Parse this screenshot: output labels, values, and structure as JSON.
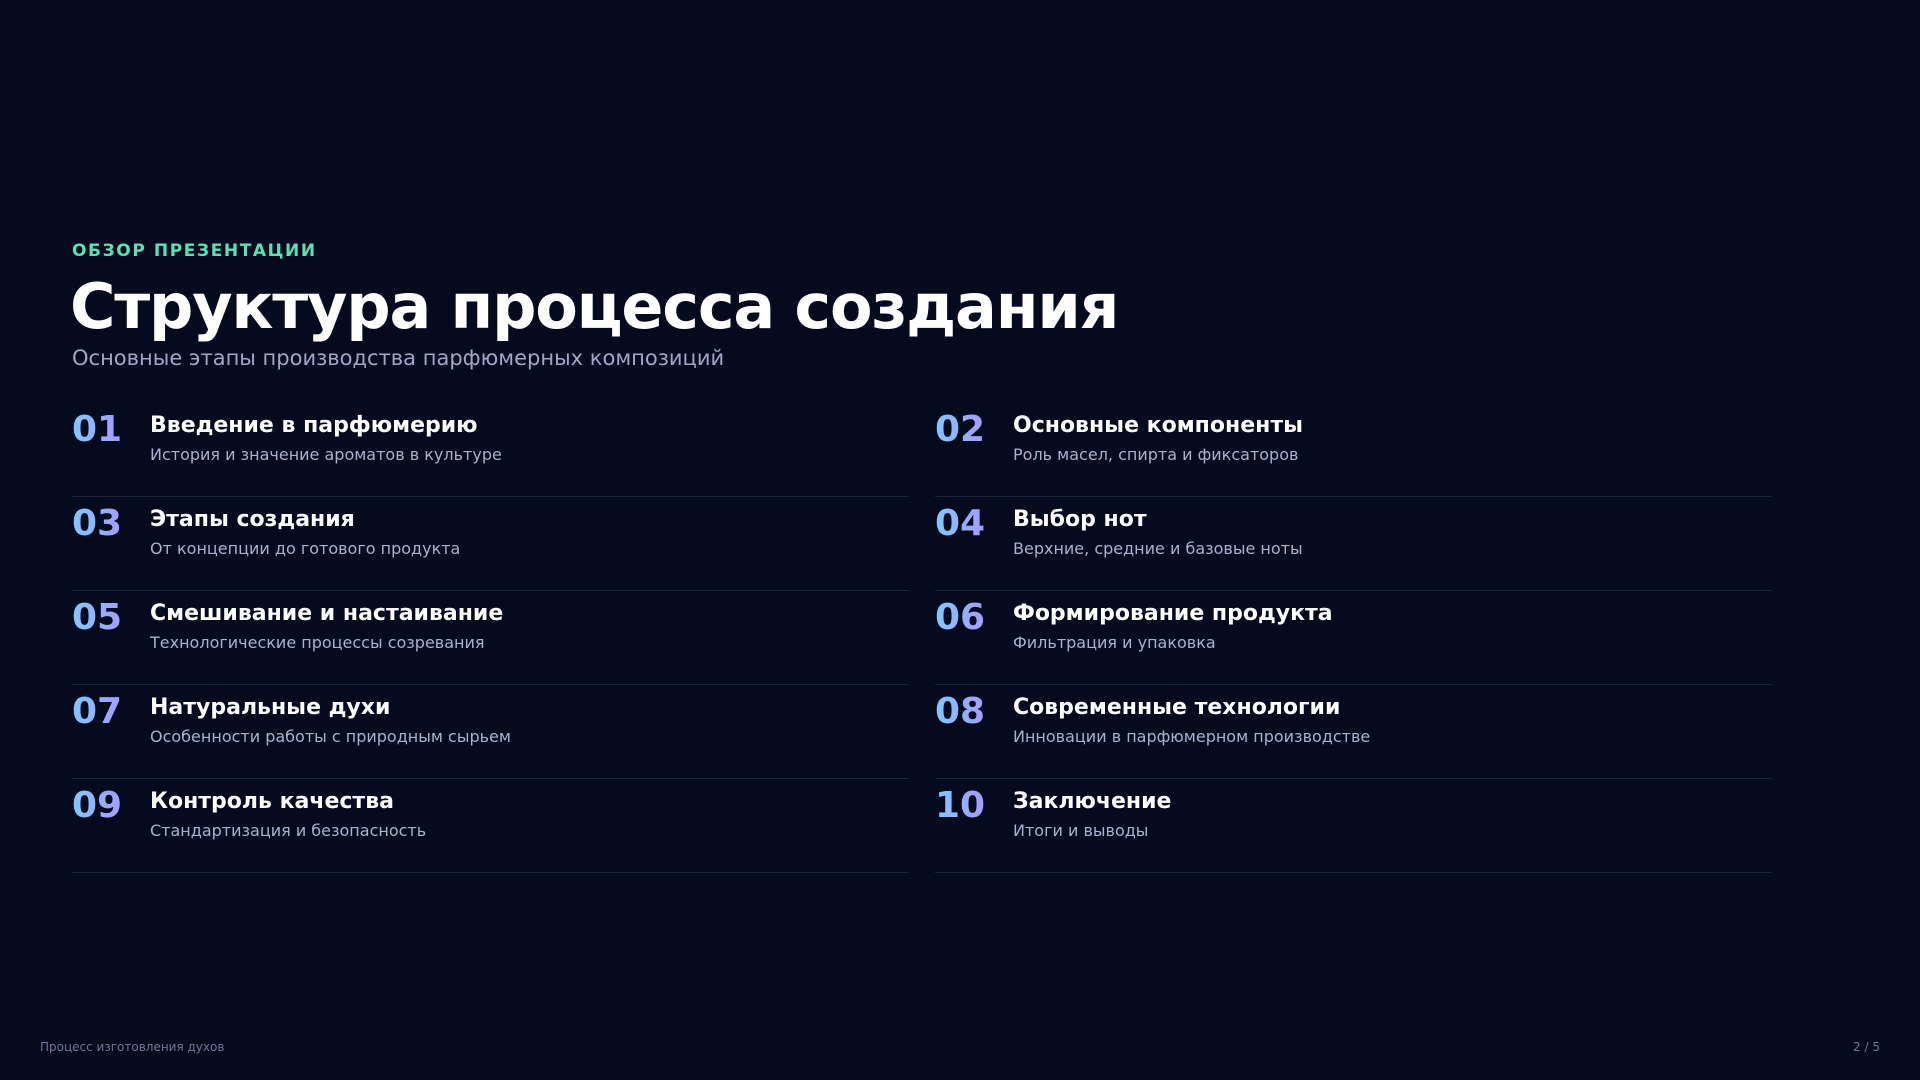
{
  "header": {
    "eyebrow": "ОБЗОР ПРЕЗЕНТАЦИИ",
    "title": "Структура процесса создания",
    "subtitle": "Основные этапы производства парфюмерных композиций"
  },
  "items": [
    {
      "num": "01",
      "title": "Введение в парфюмерию",
      "desc": "История и значение ароматов в культуре"
    },
    {
      "num": "02",
      "title": "Основные компоненты",
      "desc": "Роль масел, спирта и фиксаторов"
    },
    {
      "num": "03",
      "title": "Этапы создания",
      "desc": "От концепции до готового продукта"
    },
    {
      "num": "04",
      "title": "Выбор нот",
      "desc": "Верхние, средние и базовые ноты"
    },
    {
      "num": "05",
      "title": "Смешивание и настаивание",
      "desc": "Технологические процессы созревания"
    },
    {
      "num": "06",
      "title": "Формирование продукта",
      "desc": "Фильтрация и упаковка"
    },
    {
      "num": "07",
      "title": "Натуральные духи",
      "desc": "Особенности работы с природным сырьем"
    },
    {
      "num": "08",
      "title": "Современные технологии",
      "desc": "Инновации в парфюмерном производстве"
    },
    {
      "num": "09",
      "title": "Контроль качества",
      "desc": "Стандартизация и безопасность"
    },
    {
      "num": "10",
      "title": "Заключение",
      "desc": "Итоги и выводы"
    }
  ],
  "footer": {
    "left": "Процесс изготовления духов",
    "page": "2 / 5"
  },
  "colors": {
    "background": "#060a1e",
    "accent": "#5ee0b6",
    "number_gradient_start": "#7fc8ff",
    "number_gradient_end": "#a49cff"
  }
}
